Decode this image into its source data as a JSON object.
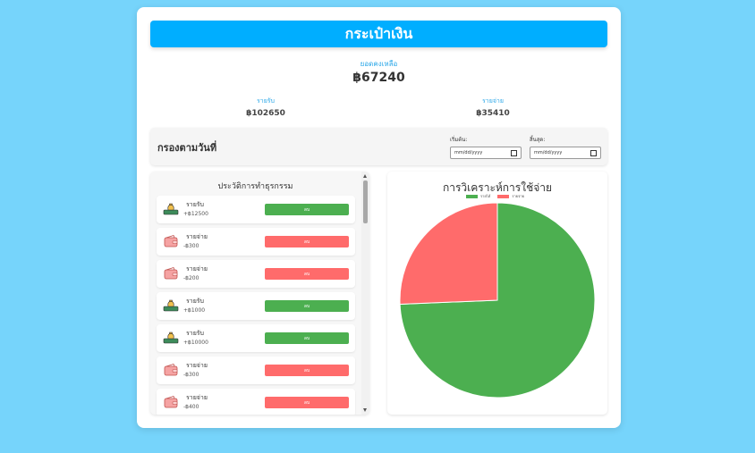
{
  "header": {
    "title": "กระเป๋าเงิน"
  },
  "summary": {
    "balance_label": "ยอดคงเหลือ",
    "balance_value": "฿67240",
    "income_label": "รายรับ",
    "income_value": "฿102650",
    "expense_label": "รายจ่าย",
    "expense_value": "฿35410"
  },
  "filter": {
    "title": "กรองตามวันที่",
    "start_label": "เริ่มต้น:",
    "start_placeholder": "mm/dd/yyyy",
    "end_label": "สิ้นสุด:",
    "end_placeholder": "mm/dd/yyyy"
  },
  "history": {
    "title": "ประวัติการทำธุรกรรม",
    "items": [
      {
        "type": "รายรับ",
        "amount": "+฿12500",
        "button": "ลบ",
        "kind": "income"
      },
      {
        "type": "รายจ่าย",
        "amount": "-฿300",
        "button": "ลบ",
        "kind": "expense"
      },
      {
        "type": "รายจ่าย",
        "amount": "-฿200",
        "button": "ลบ",
        "kind": "expense"
      },
      {
        "type": "รายรับ",
        "amount": "+฿1000",
        "button": "ลบ",
        "kind": "income"
      },
      {
        "type": "รายรับ",
        "amount": "+฿10000",
        "button": "ลบ",
        "kind": "income"
      },
      {
        "type": "รายจ่าย",
        "amount": "-฿300",
        "button": "ลบ",
        "kind": "expense"
      },
      {
        "type": "รายจ่าย",
        "amount": "-฿400",
        "button": "ลบ",
        "kind": "expense"
      }
    ]
  },
  "chart": {
    "title": "การวิเคราะห์การใช้จ่าย",
    "legend": [
      {
        "label": "รายได้",
        "color": "#4caf50"
      },
      {
        "label": "รายจ่าย",
        "color": "#ff6b6b"
      }
    ]
  },
  "chart_data": {
    "type": "pie",
    "title": "การวิเคราะห์การใช้จ่าย",
    "categories": [
      "รายได้",
      "รายจ่าย"
    ],
    "values": [
      102650,
      35410
    ],
    "colors": [
      "#4caf50",
      "#ff6b6b"
    ],
    "legend": "top"
  },
  "icons": {
    "income": "money-bag-icon",
    "expense": "wallet-icon"
  },
  "colors": {
    "primary": "#00aeff",
    "income": "#4caf50",
    "expense": "#ff6b6b",
    "background": "#76d4fb"
  }
}
